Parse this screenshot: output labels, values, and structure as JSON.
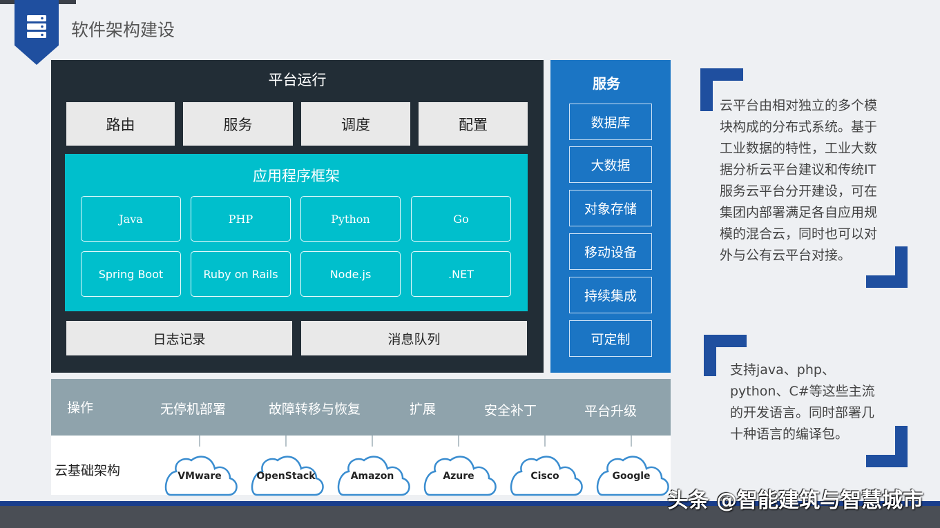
{
  "header": {
    "title": "软件架构建设",
    "icon": "server-icon"
  },
  "platform": {
    "title": "平台运行",
    "top_buttons": [
      "路由",
      "服务",
      "调度",
      "配置"
    ],
    "app_framework": {
      "title": "应用程序框架",
      "items": [
        "Java",
        "PHP",
        "Python",
        "Go",
        "Spring Boot",
        "Ruby on Rails",
        "Node.js",
        ".NET"
      ]
    },
    "bottom_buttons": [
      "日志记录",
      "消息队列"
    ]
  },
  "services": {
    "title": "服务",
    "items": [
      "数据库",
      "大数据",
      "对象存储",
      "移动设备",
      "持续集成",
      "可定制"
    ]
  },
  "operations": {
    "label": "操作",
    "items": [
      "无停机部署",
      "故障转移与恢复",
      "扩展",
      "安全补丁",
      "平台升级"
    ]
  },
  "infrastructure": {
    "label": "云基础架构",
    "clouds": [
      "VMware",
      "OpenStack",
      "Amazon",
      "Azure",
      "Cisco",
      "Google"
    ]
  },
  "descriptions": [
    {
      "lines": [
        "云平台由相对独立的多个模",
        "块构成的分布式系统。基于",
        "工业数据的特性，工业大数",
        "据分析云平台建议和传统IT",
        "服务云平台分开建设，可在",
        "集团内部署满足各自应用规",
        "模的混合云，同时也可以对",
        "外与公有云平台对接。"
      ]
    },
    {
      "lines": [
        "支持java、php、",
        "python、C#等这些主流",
        "的开发语言。同时部署几",
        "十种语言的编译包。"
      ]
    }
  ],
  "watermark": "头条 @智能建筑与智慧城市",
  "colors": {
    "dark_panel": "#222d36",
    "app_framework": "#00bfcc",
    "service_blue": "#1b75c4",
    "ops_gray": "#8fa3ac",
    "accent_navy": "#1f4f9f"
  }
}
